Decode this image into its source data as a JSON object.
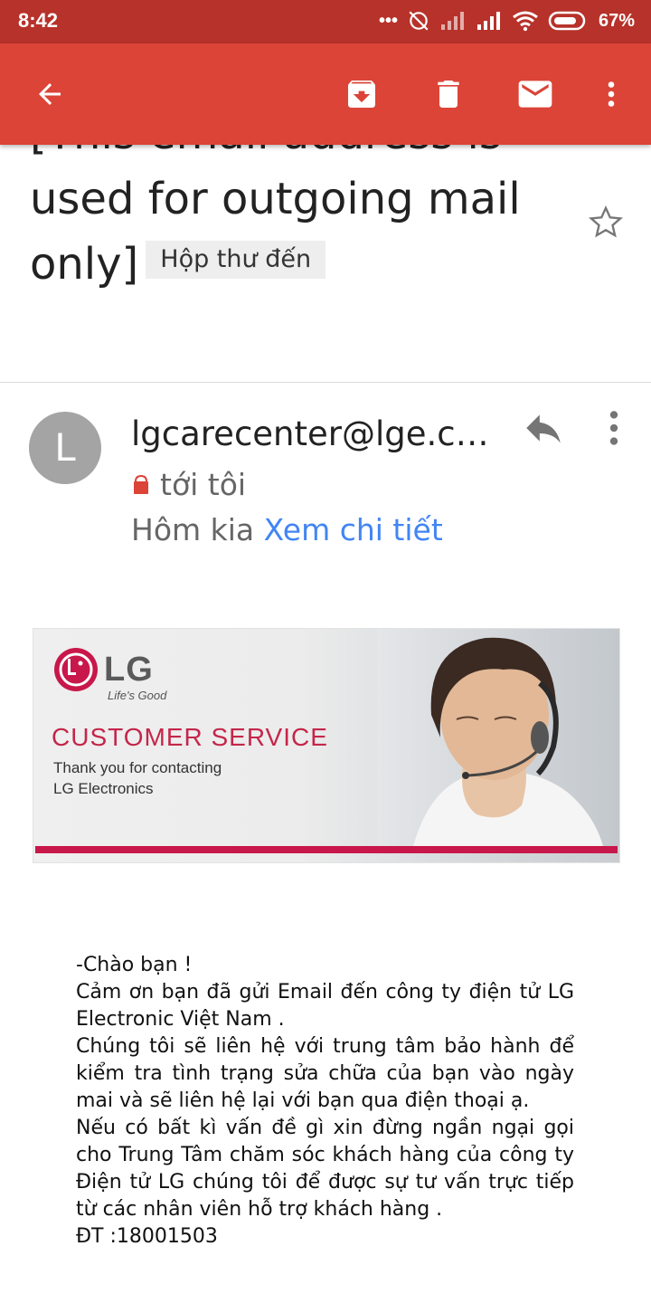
{
  "status_bar": {
    "time": "8:42",
    "dots": "•••",
    "battery_percent": "67%"
  },
  "toolbar": {
    "back_icon": "arrow-back-icon",
    "archive_icon": "archive-icon",
    "delete_icon": "delete-icon",
    "mark_unread_icon": "mail-icon",
    "more_icon": "more-vert-icon",
    "background_color": "#db4437"
  },
  "subject": {
    "text": "[This email address is used for outgoing mail only]",
    "label": "Hộp thư đến"
  },
  "message": {
    "avatar_letter": "L",
    "sender": "lgcarecenter@lge.c…",
    "to": "tới tôi",
    "date": "Hôm kia",
    "details_link": "Xem chi tiết",
    "link_color": "#4285f4"
  },
  "banner": {
    "logo_text": "LG",
    "tagline": "Life's Good",
    "title": "CUSTOMER SERVICE",
    "subtitle_line1": "Thank you for contacting",
    "subtitle_line2": "LG Electronics",
    "accent_color": "#c8174a"
  },
  "body": {
    "greeting": "-Chào bạn !",
    "p1": "Cảm ơn bạn đã gửi Email đến công ty điện tử LG Electronic Việt Nam .",
    "p2": "Chúng tôi sẽ liên hệ với trung tâm bảo hành để kiểm tra tình trạng sửa chữa của bạn vào ngày mai và sẽ liên hệ lại với bạn qua điện thoại ạ.",
    "p3": "Nếu có bất kì vấn đề gì xin đừng ngần ngại gọi cho Trung Tâm chăm sóc khách hàng của công ty Điện tử LG chúng tôi để được sự tư vấn trực tiếp từ các nhân viên hỗ trợ khách hàng .",
    "phone": "ĐT :18001503"
  }
}
